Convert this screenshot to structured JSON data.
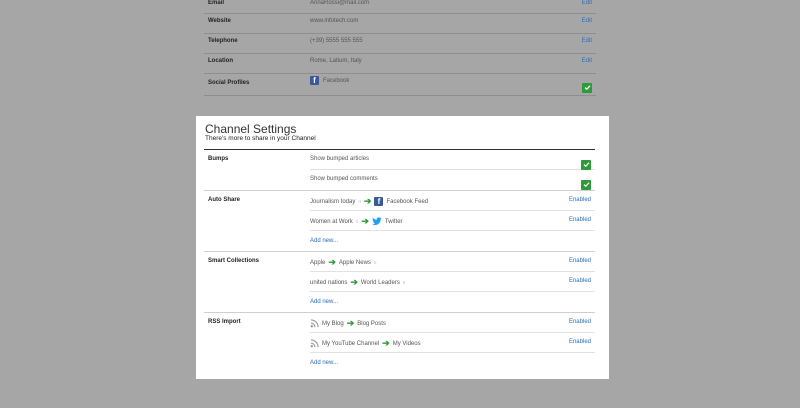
{
  "profile": {
    "rows": [
      {
        "label": "Email",
        "value": "AnnaRossi@mail.com",
        "action": "Edit"
      },
      {
        "label": "Website",
        "value": "www.infotech.com",
        "action": "Edit"
      },
      {
        "label": "Telephone",
        "value": "(+39) 5555 555 555",
        "action": "Edit"
      },
      {
        "label": "Location",
        "value": "Rome, Latium, Italy",
        "action": "Edit"
      },
      {
        "label": "Social Profiles",
        "value": "Facebook"
      }
    ]
  },
  "channel": {
    "title": "Channel Settings",
    "subtitle": "There's more to share in your Channel",
    "add_new": "Add new...",
    "enabled": "Enabled",
    "bumps": {
      "label": "Bumps",
      "rows": [
        "Show bumped articles",
        "Show bumped comments"
      ]
    },
    "auto_share": {
      "label": "Auto Share",
      "rows": [
        {
          "source": "Journalism today",
          "target": "Facebook Feed"
        },
        {
          "source": "Women at Work",
          "target": "Twitter"
        }
      ]
    },
    "smart_collections": {
      "label": "Smart Collections",
      "rows": [
        {
          "source": "Apple",
          "target": "Apple News"
        },
        {
          "source": "united nations",
          "target": "World Leaders"
        }
      ]
    },
    "rss_import": {
      "label": "RSS Import",
      "rows": [
        {
          "source": "My Blog",
          "target": "Blog Posts"
        },
        {
          "source": "My YouTube Channel",
          "target": "My Videos"
        }
      ]
    }
  },
  "colors": {
    "accent": "#2a6fb8",
    "check": "#2e9a3a",
    "facebook": "#3b5998",
    "twitter": "#1da1f2"
  }
}
